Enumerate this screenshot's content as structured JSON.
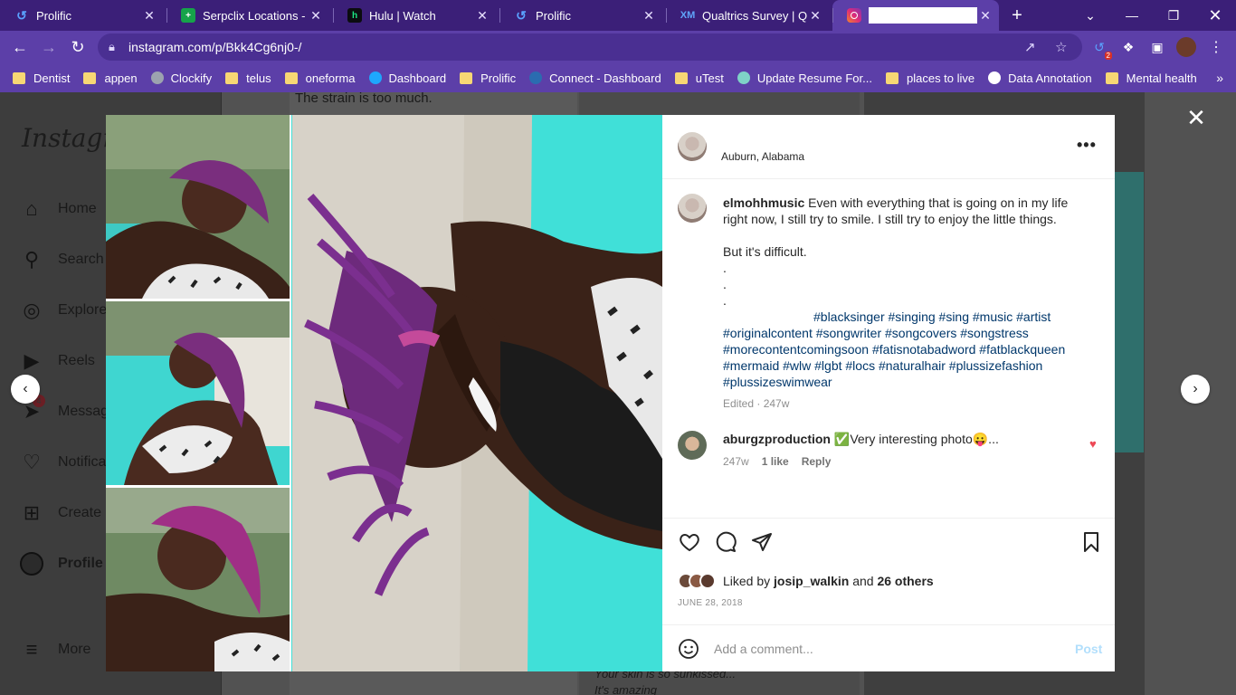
{
  "browser": {
    "tabs": [
      {
        "title": "Prolific",
        "icon": "prolific-icon",
        "color": "#2563eb"
      },
      {
        "title": "Serpclix Locations - Go",
        "icon": "serpclix-icon",
        "color": "#16a34a"
      },
      {
        "title": "Hulu | Watch",
        "icon": "hulu-icon",
        "color": "#1ce783"
      },
      {
        "title": "Prolific",
        "icon": "prolific-icon",
        "color": "#2563eb"
      },
      {
        "title": "Qualtrics Survey | Qua",
        "icon": "qualtrics-icon",
        "color": "#3b82f6"
      },
      {
        "title": "",
        "icon": "instagram-icon",
        "color": "#e1306c",
        "active": true
      }
    ],
    "url": "instagram.com/p/Bkk4Cg6nj0-/",
    "extension_badge": "2",
    "bookmarks": [
      {
        "label": "Dentist",
        "type": "folder"
      },
      {
        "label": "appen",
        "type": "folder"
      },
      {
        "label": "Clockify",
        "type": "site"
      },
      {
        "label": "telus",
        "type": "folder"
      },
      {
        "label": "oneforma",
        "type": "folder"
      },
      {
        "label": "Dashboard",
        "type": "site"
      },
      {
        "label": "Prolific",
        "type": "folder"
      },
      {
        "label": "Connect - Dashboard",
        "type": "site"
      },
      {
        "label": "uTest",
        "type": "folder"
      },
      {
        "label": "Update Resume For...",
        "type": "site"
      },
      {
        "label": "places to live",
        "type": "folder"
      },
      {
        "label": "Data Annotation",
        "type": "site"
      },
      {
        "label": "Mental health",
        "type": "folder"
      }
    ]
  },
  "sidebar": {
    "logo": "Instagram",
    "items": [
      {
        "label": "Home",
        "icon": "home-icon"
      },
      {
        "label": "Search",
        "icon": "search-icon"
      },
      {
        "label": "Explore",
        "icon": "explore-icon"
      },
      {
        "label": "Reels",
        "icon": "reels-icon"
      },
      {
        "label": "Messages",
        "icon": "messenger-icon",
        "badge": "4"
      },
      {
        "label": "Notifications",
        "icon": "heart-icon"
      },
      {
        "label": "Create",
        "icon": "create-icon"
      },
      {
        "label": "Profile",
        "icon": "avatar"
      },
      {
        "label": "More",
        "icon": "menu-icon"
      }
    ]
  },
  "background": {
    "top_text": "The strain is too much.",
    "bottom_text_1": "Your skin is so sunkissed...",
    "bottom_text_2": "It's amazing"
  },
  "post": {
    "location": "Auburn, Alabama",
    "caption": {
      "username": "elmohhmusic",
      "text": "Even with everything that is going on in my life right now, I still try to smile. I still try to enjoy the little things.",
      "line2": "But it's difficult.",
      "dots": [
        ".",
        ".",
        "."
      ],
      "hashtags_line1": "#blacksinger #singing #sing #music #artist",
      "hashtags_rest": "#originalcontent #songwriter #songcovers #songstress #morecontentcomingsoon #fatisnotabadword #fatblackqueen #mermaid #wlw #lgbt #locs #naturalhair #plussizefashion #plussizeswimwear",
      "meta": "Edited · 247w"
    },
    "comment": {
      "username": "aburgzproduction",
      "text": "✅Very interesting photo😛...",
      "age": "247w",
      "likes": "1 like",
      "reply": "Reply"
    },
    "liked_by_prefix": "Liked by",
    "liked_by_user": "josip_walkin",
    "liked_by_and": "and",
    "liked_by_others": "26 others",
    "date": "JUNE 28, 2018",
    "add_comment_placeholder": "Add a comment...",
    "post_button": "Post"
  },
  "colors": {
    "tabbar": "#3b1f78",
    "toolbar": "#5c3fa8",
    "like_heart": "#ed4956",
    "hashtag": "#00376b",
    "pool": "#40e0d8"
  }
}
